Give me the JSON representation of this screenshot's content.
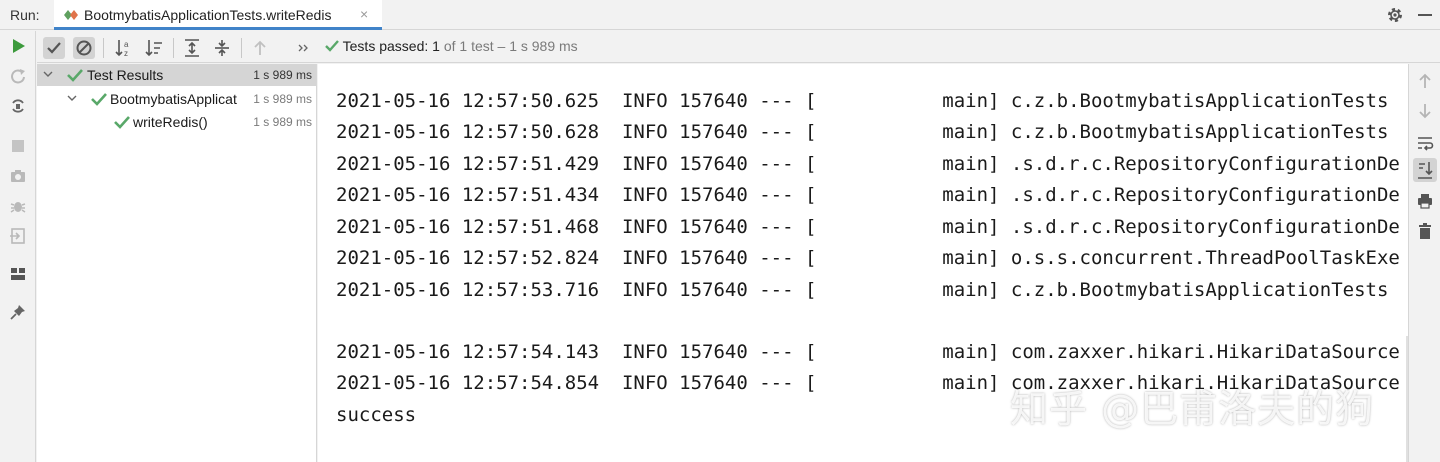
{
  "topbar": {
    "run_label": "Run:",
    "tab_title": "BootmybatisApplicationTests.writeRedis",
    "close_glyph": "×",
    "icons": [
      "settings-gear-icon",
      "minimize-icon"
    ]
  },
  "left_toolbar": {
    "icons": [
      "run-icon",
      "rerun-failed-icon",
      "toggle-auto-test-icon",
      "stop-icon",
      "camera-dump-icon",
      "debug-bug-icon",
      "exit-icon",
      "layout-icon",
      "pin-icon"
    ]
  },
  "test_toolbar": {
    "icons": [
      "show-passed-check-icon",
      "show-ignored-icon",
      "sort-alpha-icon",
      "sort-duration-icon",
      "expand-all-icon",
      "collapse-all-icon",
      "previous-failed-icon",
      "more-chevrons-icon"
    ],
    "status_prefix": "Tests passed: ",
    "status_count": "1",
    "status_detail": " of 1 test – 1 s 989 ms"
  },
  "tree": {
    "rows": [
      {
        "label": "Test Results",
        "time": "1 s 989 ms"
      },
      {
        "label": "BootmybatisApplicat",
        "time": "1 s 989 ms"
      },
      {
        "label": "writeRedis()",
        "time": "1 s 989 ms"
      }
    ]
  },
  "console": {
    "lines": [
      "2021-05-16 12:57:50.625  INFO 157640 --- [           main] c.z.b.BootmybatisApplicationTests",
      "2021-05-16 12:57:50.628  INFO 157640 --- [           main] c.z.b.BootmybatisApplicationTests",
      "2021-05-16 12:57:51.429  INFO 157640 --- [           main] .s.d.r.c.RepositoryConfigurationDe",
      "2021-05-16 12:57:51.434  INFO 157640 --- [           main] .s.d.r.c.RepositoryConfigurationDe",
      "2021-05-16 12:57:51.468  INFO 157640 --- [           main] .s.d.r.c.RepositoryConfigurationDe",
      "2021-05-16 12:57:52.824  INFO 157640 --- [           main] o.s.s.concurrent.ThreadPoolTaskExe",
      "2021-05-16 12:57:53.716  INFO 157640 --- [           main] c.z.b.BootmybatisApplicationTests",
      "",
      "2021-05-16 12:57:54.143  INFO 157640 --- [           main] com.zaxxer.hikari.HikariDataSource",
      "2021-05-16 12:57:54.854  INFO 157640 --- [           main] com.zaxxer.hikari.HikariDataSource",
      "success"
    ]
  },
  "right_toolbar": {
    "icons": [
      "up-arrow-icon",
      "down-arrow-icon",
      "soft-wrap-icon",
      "scroll-to-end-icon",
      "print-icon",
      "trash-icon"
    ]
  },
  "watermark": "知乎 @巴甫洛夫的狗",
  "colors": {
    "accent": "#4083c9",
    "success_green": "#59a869",
    "run_green": "#3c9a3c",
    "panel_bg": "#f2f2f2",
    "selected_row": "#d5d5d5"
  }
}
